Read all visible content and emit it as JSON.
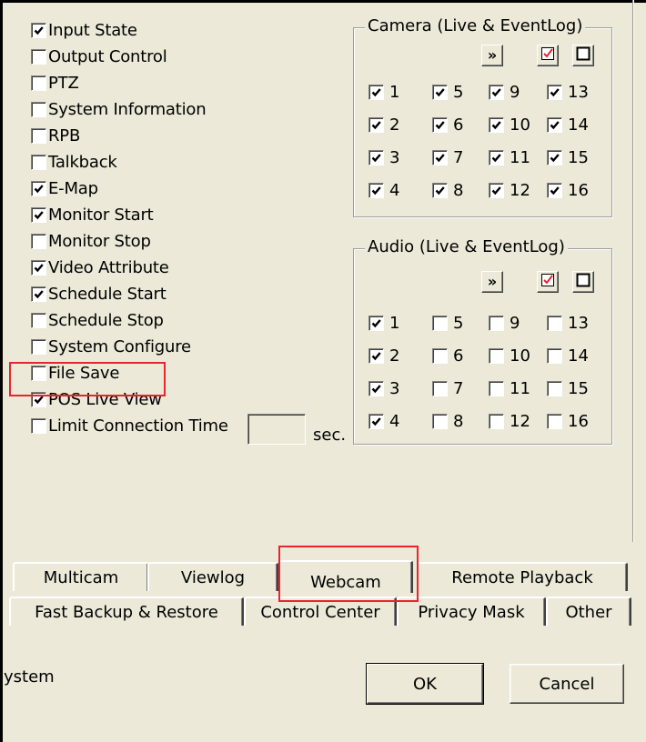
{
  "permissions": [
    {
      "label": "Input State",
      "checked": true
    },
    {
      "label": "Output Control",
      "checked": false
    },
    {
      "label": "PTZ",
      "checked": false
    },
    {
      "label": "System Information",
      "checked": false
    },
    {
      "label": "RPB",
      "checked": false
    },
    {
      "label": "Talkback",
      "checked": false
    },
    {
      "label": "E-Map",
      "checked": true
    },
    {
      "label": "Monitor Start",
      "checked": true
    },
    {
      "label": "Monitor Stop",
      "checked": false
    },
    {
      "label": "Video Attribute",
      "checked": true
    },
    {
      "label": "Schedule Start",
      "checked": true
    },
    {
      "label": "Schedule Stop",
      "checked": false
    },
    {
      "label": "System Configure",
      "checked": false
    },
    {
      "label": "File Save",
      "checked": false
    },
    {
      "label": "POS Live View",
      "checked": true
    },
    {
      "label": "Limit Connection Time",
      "checked": false
    }
  ],
  "limit_connection": {
    "value": "",
    "unit_label": "sec."
  },
  "camera": {
    "title": "Camera (Live & EventLog)",
    "channels": [
      {
        "n": "1",
        "checked": true
      },
      {
        "n": "2",
        "checked": true
      },
      {
        "n": "3",
        "checked": true
      },
      {
        "n": "4",
        "checked": true
      },
      {
        "n": "5",
        "checked": true
      },
      {
        "n": "6",
        "checked": true
      },
      {
        "n": "7",
        "checked": true
      },
      {
        "n": "8",
        "checked": true
      },
      {
        "n": "9",
        "checked": true
      },
      {
        "n": "10",
        "checked": true
      },
      {
        "n": "11",
        "checked": true
      },
      {
        "n": "12",
        "checked": true
      },
      {
        "n": "13",
        "checked": true
      },
      {
        "n": "14",
        "checked": true
      },
      {
        "n": "15",
        "checked": true
      },
      {
        "n": "16",
        "checked": true
      }
    ]
  },
  "audio": {
    "title": "Audio (Live & EventLog)",
    "channels": [
      {
        "n": "1",
        "checked": true
      },
      {
        "n": "2",
        "checked": true
      },
      {
        "n": "3",
        "checked": true
      },
      {
        "n": "4",
        "checked": true
      },
      {
        "n": "5",
        "checked": false
      },
      {
        "n": "6",
        "checked": false
      },
      {
        "n": "7",
        "checked": false
      },
      {
        "n": "8",
        "checked": false
      },
      {
        "n": "9",
        "checked": false
      },
      {
        "n": "10",
        "checked": false
      },
      {
        "n": "11",
        "checked": false
      },
      {
        "n": "12",
        "checked": false
      },
      {
        "n": "13",
        "checked": false
      },
      {
        "n": "14",
        "checked": false
      },
      {
        "n": "15",
        "checked": false
      },
      {
        "n": "16",
        "checked": false
      }
    ]
  },
  "group_buttons": {
    "next": "»"
  },
  "tabs_row1": [
    "Multicam",
    "Viewlog",
    "Webcam",
    "Remote Playback"
  ],
  "tabs_row2": [
    "Fast Backup & Restore",
    "Control Center",
    "Privacy Mask",
    "Other"
  ],
  "active_tab": "Webcam",
  "footer": {
    "partial_text": "ystem",
    "ok_label": "OK",
    "cancel_label": "Cancel"
  },
  "colors": {
    "highlight": "#e8242f",
    "window_bg": "#ece9d8"
  }
}
